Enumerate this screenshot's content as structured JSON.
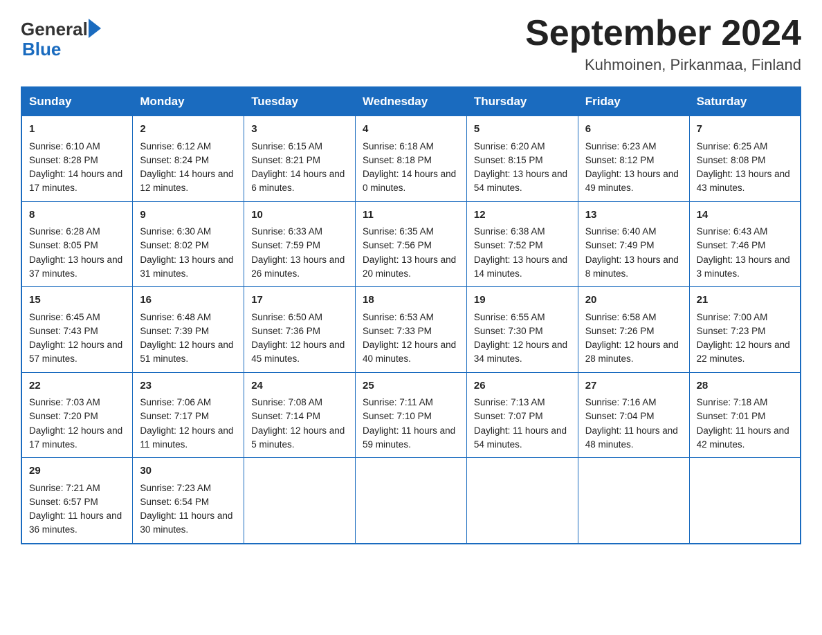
{
  "header": {
    "logo_general": "General",
    "logo_blue": "Blue",
    "title": "September 2024",
    "location": "Kuhmoinen, Pirkanmaa, Finland"
  },
  "days_of_week": [
    "Sunday",
    "Monday",
    "Tuesday",
    "Wednesday",
    "Thursday",
    "Friday",
    "Saturday"
  ],
  "weeks": [
    [
      {
        "day": "1",
        "sunrise": "6:10 AM",
        "sunset": "8:28 PM",
        "daylight": "14 hours and 17 minutes."
      },
      {
        "day": "2",
        "sunrise": "6:12 AM",
        "sunset": "8:24 PM",
        "daylight": "14 hours and 12 minutes."
      },
      {
        "day": "3",
        "sunrise": "6:15 AM",
        "sunset": "8:21 PM",
        "daylight": "14 hours and 6 minutes."
      },
      {
        "day": "4",
        "sunrise": "6:18 AM",
        "sunset": "8:18 PM",
        "daylight": "14 hours and 0 minutes."
      },
      {
        "day": "5",
        "sunrise": "6:20 AM",
        "sunset": "8:15 PM",
        "daylight": "13 hours and 54 minutes."
      },
      {
        "day": "6",
        "sunrise": "6:23 AM",
        "sunset": "8:12 PM",
        "daylight": "13 hours and 49 minutes."
      },
      {
        "day": "7",
        "sunrise": "6:25 AM",
        "sunset": "8:08 PM",
        "daylight": "13 hours and 43 minutes."
      }
    ],
    [
      {
        "day": "8",
        "sunrise": "6:28 AM",
        "sunset": "8:05 PM",
        "daylight": "13 hours and 37 minutes."
      },
      {
        "day": "9",
        "sunrise": "6:30 AM",
        "sunset": "8:02 PM",
        "daylight": "13 hours and 31 minutes."
      },
      {
        "day": "10",
        "sunrise": "6:33 AM",
        "sunset": "7:59 PM",
        "daylight": "13 hours and 26 minutes."
      },
      {
        "day": "11",
        "sunrise": "6:35 AM",
        "sunset": "7:56 PM",
        "daylight": "13 hours and 20 minutes."
      },
      {
        "day": "12",
        "sunrise": "6:38 AM",
        "sunset": "7:52 PM",
        "daylight": "13 hours and 14 minutes."
      },
      {
        "day": "13",
        "sunrise": "6:40 AM",
        "sunset": "7:49 PM",
        "daylight": "13 hours and 8 minutes."
      },
      {
        "day": "14",
        "sunrise": "6:43 AM",
        "sunset": "7:46 PM",
        "daylight": "13 hours and 3 minutes."
      }
    ],
    [
      {
        "day": "15",
        "sunrise": "6:45 AM",
        "sunset": "7:43 PM",
        "daylight": "12 hours and 57 minutes."
      },
      {
        "day": "16",
        "sunrise": "6:48 AM",
        "sunset": "7:39 PM",
        "daylight": "12 hours and 51 minutes."
      },
      {
        "day": "17",
        "sunrise": "6:50 AM",
        "sunset": "7:36 PM",
        "daylight": "12 hours and 45 minutes."
      },
      {
        "day": "18",
        "sunrise": "6:53 AM",
        "sunset": "7:33 PM",
        "daylight": "12 hours and 40 minutes."
      },
      {
        "day": "19",
        "sunrise": "6:55 AM",
        "sunset": "7:30 PM",
        "daylight": "12 hours and 34 minutes."
      },
      {
        "day": "20",
        "sunrise": "6:58 AM",
        "sunset": "7:26 PM",
        "daylight": "12 hours and 28 minutes."
      },
      {
        "day": "21",
        "sunrise": "7:00 AM",
        "sunset": "7:23 PM",
        "daylight": "12 hours and 22 minutes."
      }
    ],
    [
      {
        "day": "22",
        "sunrise": "7:03 AM",
        "sunset": "7:20 PM",
        "daylight": "12 hours and 17 minutes."
      },
      {
        "day": "23",
        "sunrise": "7:06 AM",
        "sunset": "7:17 PM",
        "daylight": "12 hours and 11 minutes."
      },
      {
        "day": "24",
        "sunrise": "7:08 AM",
        "sunset": "7:14 PM",
        "daylight": "12 hours and 5 minutes."
      },
      {
        "day": "25",
        "sunrise": "7:11 AM",
        "sunset": "7:10 PM",
        "daylight": "11 hours and 59 minutes."
      },
      {
        "day": "26",
        "sunrise": "7:13 AM",
        "sunset": "7:07 PM",
        "daylight": "11 hours and 54 minutes."
      },
      {
        "day": "27",
        "sunrise": "7:16 AM",
        "sunset": "7:04 PM",
        "daylight": "11 hours and 48 minutes."
      },
      {
        "day": "28",
        "sunrise": "7:18 AM",
        "sunset": "7:01 PM",
        "daylight": "11 hours and 42 minutes."
      }
    ],
    [
      {
        "day": "29",
        "sunrise": "7:21 AM",
        "sunset": "6:57 PM",
        "daylight": "11 hours and 36 minutes."
      },
      {
        "day": "30",
        "sunrise": "7:23 AM",
        "sunset": "6:54 PM",
        "daylight": "11 hours and 30 minutes."
      },
      null,
      null,
      null,
      null,
      null
    ]
  ],
  "labels": {
    "sunrise_prefix": "Sunrise: ",
    "sunset_prefix": "Sunset: ",
    "daylight_prefix": "Daylight: "
  }
}
